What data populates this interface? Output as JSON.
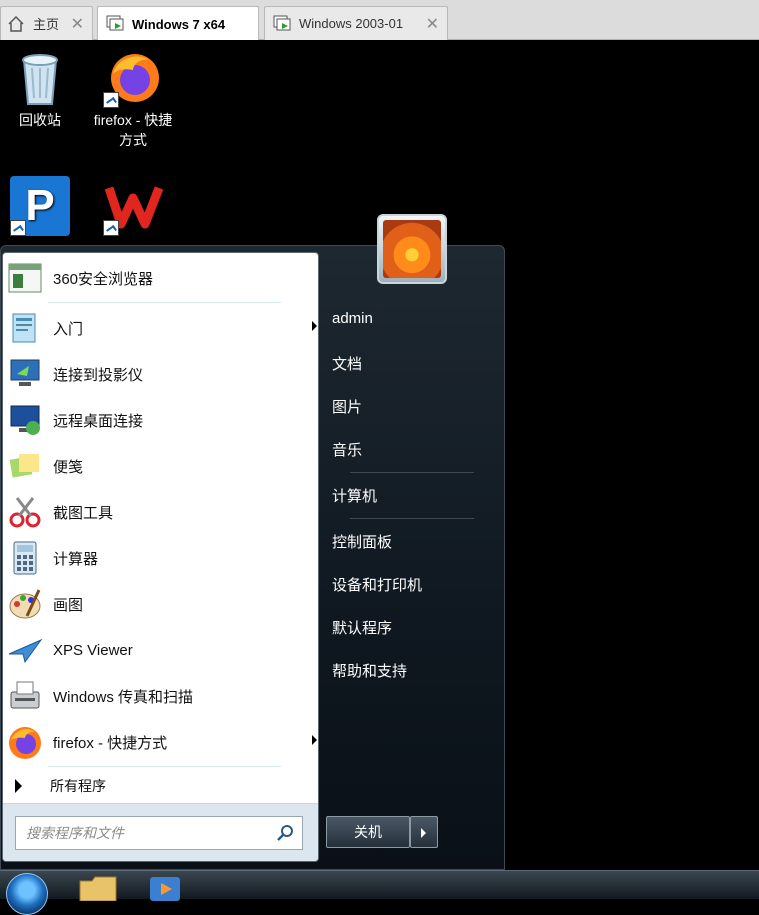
{
  "tabs": [
    {
      "label": "主页",
      "icon": "home-icon",
      "active": false
    },
    {
      "label": "Windows 7 x64",
      "icon": "vm-icon",
      "active": true
    },
    {
      "label": "Windows  2003-01",
      "icon": "vm-icon",
      "active": false
    }
  ],
  "desktop_icons": [
    {
      "label": "回收站",
      "icon": "recycle-bin-icon"
    },
    {
      "label": "firefox - 快捷方式",
      "icon": "firefox-icon"
    },
    {
      "label": "",
      "icon": "p-app-icon"
    },
    {
      "label": "",
      "icon": "wps-icon"
    }
  ],
  "start_menu": {
    "programs": [
      {
        "label": "360安全浏览器",
        "icon": "browser-360-icon",
        "submenu": false
      },
      {
        "label": "入门",
        "icon": "getting-started-icon",
        "submenu": true
      },
      {
        "label": "连接到投影仪",
        "icon": "projector-icon",
        "submenu": false
      },
      {
        "label": "远程桌面连接",
        "icon": "remote-desktop-icon",
        "submenu": false
      },
      {
        "label": "便笺",
        "icon": "sticky-notes-icon",
        "submenu": false
      },
      {
        "label": "截图工具",
        "icon": "snipping-tool-icon",
        "submenu": false
      },
      {
        "label": "计算器",
        "icon": "calculator-icon",
        "submenu": false
      },
      {
        "label": "画图",
        "icon": "paint-icon",
        "submenu": false
      },
      {
        "label": "XPS Viewer",
        "icon": "xps-viewer-icon",
        "submenu": false
      },
      {
        "label": "Windows 传真和扫描",
        "icon": "fax-scan-icon",
        "submenu": false
      },
      {
        "label": "firefox - 快捷方式",
        "icon": "firefox-icon",
        "submenu": true
      }
    ],
    "all_programs": "所有程序",
    "search_placeholder": "搜索程序和文件",
    "right_items": [
      "admin",
      "文档",
      "图片",
      "音乐",
      "计算机",
      "控制面板",
      "设备和打印机",
      "默认程序",
      "帮助和支持"
    ],
    "shutdown_label": "关机"
  }
}
